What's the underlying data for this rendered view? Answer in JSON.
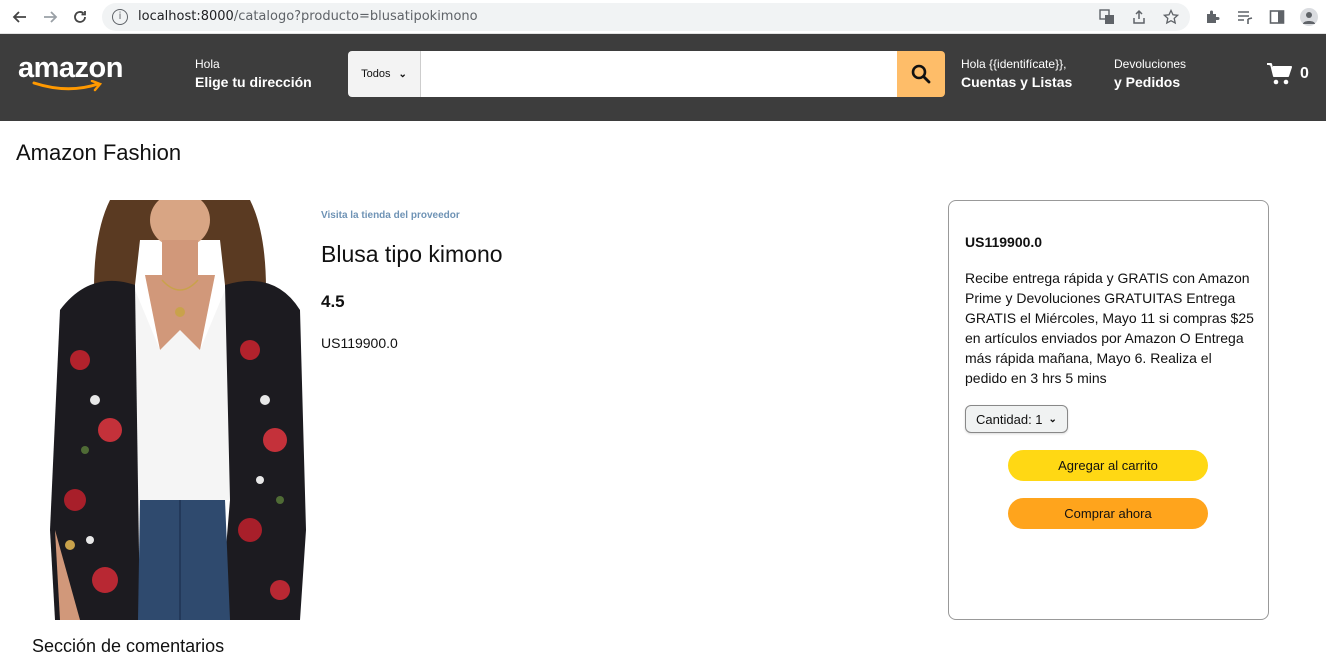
{
  "browser": {
    "url_host": "localhost:8000",
    "url_path": "/catalogo?producto=blusatipokimono"
  },
  "header": {
    "logo_text": "amazon",
    "address_greeting": "Hola",
    "address_label": "Elige tu dirección",
    "search_category": "Todos",
    "search_placeholder": "",
    "account_greeting": "Hola {{identifícate}},",
    "account_label": "Cuentas y Listas",
    "returns_line1": "Devoluciones",
    "returns_line2": "y Pedidos",
    "cart_count": "0"
  },
  "page": {
    "section_title": "Amazon Fashion",
    "comments_title": "Sección de comentarios"
  },
  "product": {
    "store_link": "Visita la tienda del proveedor",
    "title": "Blusa tipo kimono",
    "rating": "4.5",
    "price": "US119900.0"
  },
  "buybox": {
    "price": "US119900.0",
    "description": "Recibe entrega rápida y GRATIS con Amazon Prime y Devoluciones GRATUITAS Entrega GRATIS el Miércoles, Mayo 11 si compras $25 en artículos enviados por Amazon O Entrega más rápida mañana, Mayo 6. Realiza el pedido en 3 hrs 5 mins",
    "quantity_label": "Cantidad: 1",
    "add_to_cart": "Agregar al carrito",
    "buy_now": "Comprar ahora"
  },
  "colors": {
    "header_bg": "#3d3d3d",
    "search_button": "#febd69",
    "add_to_cart": "#ffd814",
    "buy_now": "#ffa41c",
    "store_link": "#6f93b5"
  },
  "icons": [
    "back-arrow-icon",
    "forward-arrow-icon",
    "reload-icon",
    "info-icon",
    "translate-icon",
    "share-icon",
    "star-icon",
    "puzzle-icon",
    "playlist-icon",
    "sidepanel-icon",
    "profile-icon",
    "search-icon",
    "cart-icon"
  ]
}
